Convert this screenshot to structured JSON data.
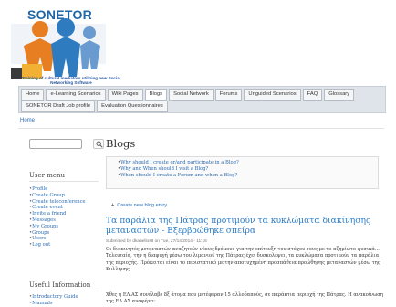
{
  "site": {
    "logo_text": "SONETOR",
    "tagline": "Training of cultural mediators utilizing new Social Networking Software"
  },
  "nav": {
    "row1": [
      "Home",
      "e-Learning Scenarios",
      "Wiki Pages",
      "Blogs",
      "Social Network",
      "Forums",
      "Unguided Scenarios",
      "FAQ",
      "Glossary"
    ],
    "row2": [
      "SONETOR Draft Job profile",
      "Evaluation Questionnaires"
    ],
    "active": "Blogs"
  },
  "breadcrumb": "Home",
  "sidebar": {
    "user_menu_title": "User menu",
    "user_menu": [
      "Profile",
      "Create Group",
      "Create teleconference",
      "Create event",
      "Invite a friend",
      "Messages",
      "My Groups",
      "Groups",
      "Users",
      "Log out"
    ],
    "useful_title": "Useful Information",
    "useful": [
      "Introductory Guide",
      "Manuals"
    ]
  },
  "main": {
    "title": "Blogs",
    "faq": [
      "Why should I create or/and participate in a Blog?",
      "Why and When should I visit a Blog?",
      "When should I create a Forum and when a Blog?"
    ],
    "create_entry": "Create new blog entry",
    "post": {
      "title": "Τα παράλια της Πάτρας προτιμούν τα κυκλώματα διακίνησης μεταναστών - Εξερβρώθηκε σπείρα",
      "submitted": "Submitted by dkanellos8 on Tue, 27/14/2014 - 11:16",
      "body": "Οι διακινητές μεταναστών αναζητούν νέους δρόμους για την επίτευξη του στόχου τους με το αζημίωτο φυσικά…Τελευταία, την η διαφυγή μέσω του λιμανιού της Πάτρας έχει δυσκολέψει, τα κυκλώματα προτιμούν τα παράλια της περιοχής. Πρόκειται είναι το περιστατικό με την αποτυχημένη προσπάθεια προώθησης μεταναστών μέσω της Κυλλήνης.",
      "body2": "Χθες η ΕΛ.ΑΣ συνέλαβε 8ξ άτομα που μετέφεραν 15 αλλοδαπούς, σε παράκτια περιοχή της Πάτρας. Η ανακοίνωση της ΕΛ.ΑΣ αναφέρει:"
    }
  },
  "colors": {
    "link": "#2a6bb1",
    "post_title": "#2a7bc4",
    "logo": "#1e66a6",
    "nav_bg": "#dfe4ea"
  }
}
